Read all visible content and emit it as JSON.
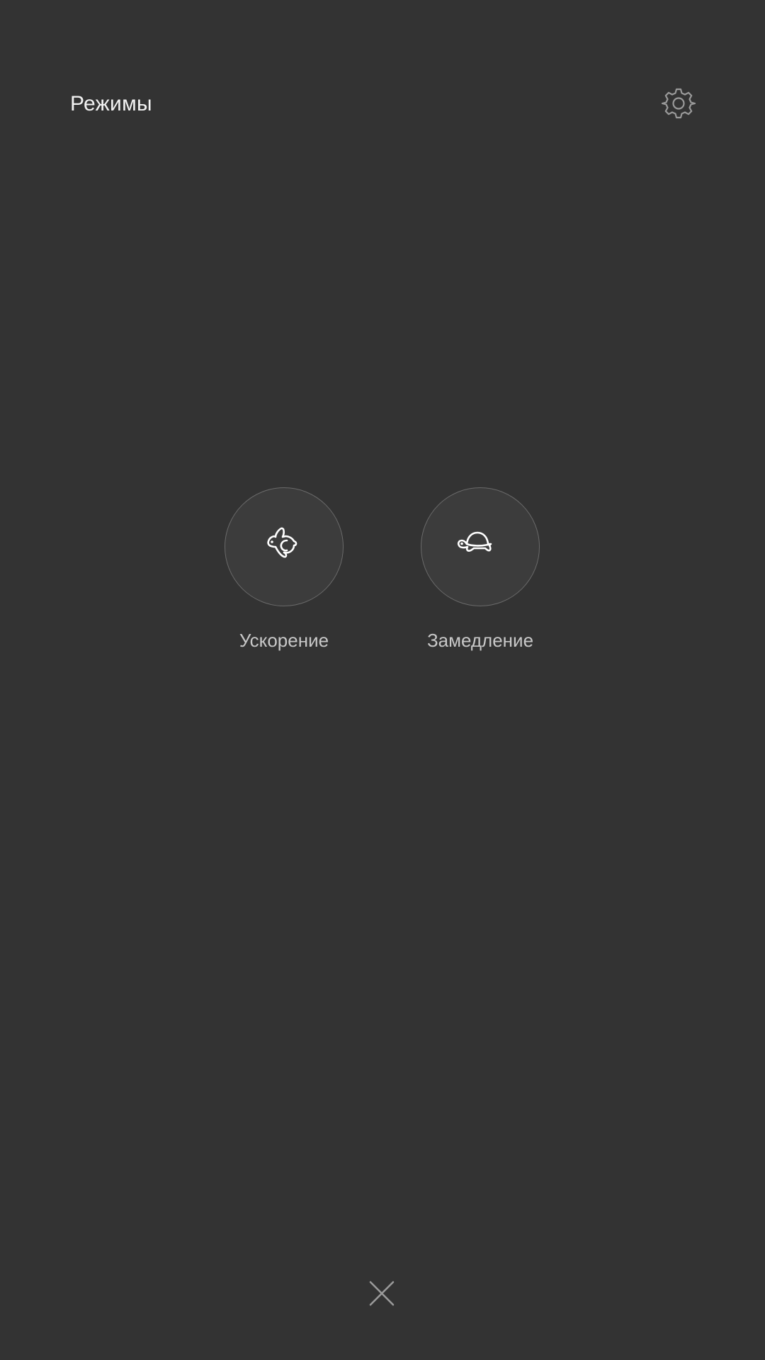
{
  "header": {
    "title": "Режимы",
    "settings_icon": "gear-icon"
  },
  "modes": [
    {
      "label": "Ускорение",
      "icon": "rabbit-icon"
    },
    {
      "label": "Замедление",
      "icon": "turtle-icon"
    }
  ],
  "footer": {
    "close_icon": "close-icon"
  },
  "colors": {
    "background": "#333333",
    "circle_fill": "#3c3c3c",
    "circle_border": "#6a6a6a",
    "title_text": "#f2f2f2",
    "label_text": "#c8c8c8",
    "icon_muted": "#9a9a9a"
  }
}
